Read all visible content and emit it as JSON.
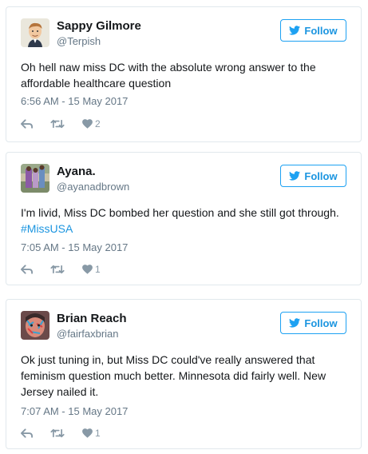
{
  "colors": {
    "accent": "#1da1f2",
    "text": "#14171a",
    "muted": "#657786",
    "icon": "#8899a6",
    "border": "#e1e8ed"
  },
  "tweets": [
    {
      "name": "Sappy Gilmore",
      "handle": "@Terpish",
      "follow_label": "Follow",
      "text": "Oh hell naw miss DC with the absolute wrong answer to the affordable healthcare question",
      "hashtag": "",
      "timestamp": "6:56 AM - 15 May 2017",
      "like_count": "2",
      "icons": [
        "reply-icon",
        "retweet-icon",
        "like-icon"
      ]
    },
    {
      "name": "Ayana.",
      "handle": "@ayanadbrown",
      "follow_label": "Follow",
      "text": "I'm livid, Miss DC bombed her question and she still got through.",
      "hashtag": "#MissUSA",
      "timestamp": "7:05 AM - 15 May 2017",
      "like_count": "1",
      "icons": [
        "reply-icon",
        "retweet-icon",
        "like-icon"
      ]
    },
    {
      "name": "Brian Reach",
      "handle": "@fairfaxbrian",
      "follow_label": "Follow",
      "text": "Ok just tuning in, but Miss DC could've really answered that feminism question much better. Minnesota did fairly well. New Jersey nailed it.",
      "hashtag": "",
      "timestamp": "7:07 AM - 15 May 2017",
      "like_count": "1",
      "icons": [
        "reply-icon",
        "retweet-icon",
        "like-icon"
      ]
    }
  ]
}
